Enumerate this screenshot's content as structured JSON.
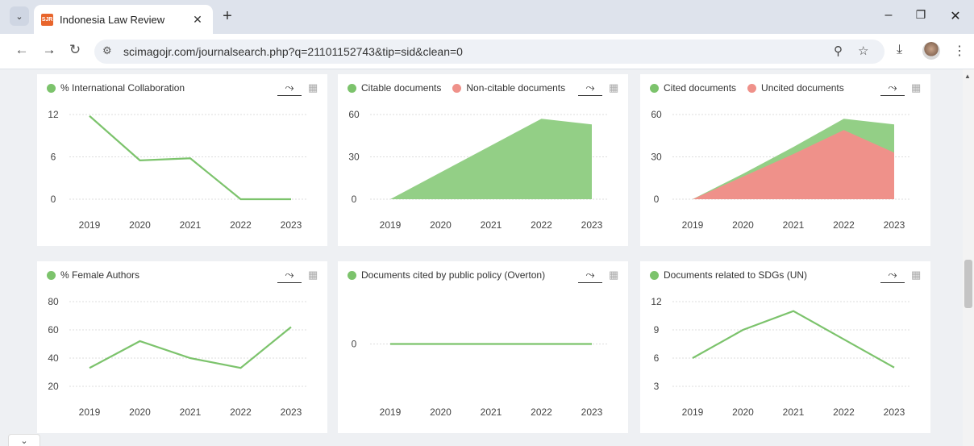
{
  "browser": {
    "tab_title": "Indonesia Law Review",
    "favicon_text": "SJR",
    "url": "scimagojr.com/journalsearch.php?q=21101152743&tip=sid&clean=0"
  },
  "colors": {
    "green": "#93cf86",
    "green_line": "#7cc36c",
    "red": "#ef918a"
  },
  "cards": [
    {
      "legend": [
        {
          "label": "% International Collaboration",
          "color": "#7cc36c"
        }
      ],
      "chart_data": {
        "type": "line",
        "x": [
          "2019",
          "2020",
          "2021",
          "2022",
          "2023"
        ],
        "series": [
          {
            "name": "% International Collaboration",
            "values": [
              11.8,
              5.5,
              5.8,
              0,
              0
            ]
          }
        ],
        "yticks": [
          "12",
          "6",
          "0"
        ],
        "ylim": [
          0,
          12
        ]
      }
    },
    {
      "legend": [
        {
          "label": "Citable documents",
          "color": "#7cc36c"
        },
        {
          "label": "Non-citable documents",
          "color": "#ef918a"
        }
      ],
      "chart_data": {
        "type": "area",
        "x": [
          "2019",
          "2020",
          "2021",
          "2022",
          "2023"
        ],
        "series": [
          {
            "name": "Citable documents",
            "values": [
              0,
              19,
              38,
              57,
              53
            ]
          },
          {
            "name": "Non-citable documents",
            "values": [
              0,
              0,
              0,
              0,
              0
            ]
          }
        ],
        "yticks": [
          "60",
          "30",
          "0"
        ],
        "ylim": [
          0,
          60
        ]
      }
    },
    {
      "legend": [
        {
          "label": "Cited documents",
          "color": "#7cc36c"
        },
        {
          "label": "Uncited documents",
          "color": "#ef918a"
        }
      ],
      "chart_data": {
        "type": "area",
        "x": [
          "2019",
          "2020",
          "2021",
          "2022",
          "2023"
        ],
        "series": [
          {
            "name": "Cited documents",
            "values": [
              0,
              18,
              37,
              57,
              53
            ]
          },
          {
            "name": "Uncited documents",
            "values": [
              0,
              16,
              32,
              49,
              33
            ]
          }
        ],
        "yticks": [
          "60",
          "30",
          "0"
        ],
        "ylim": [
          0,
          60
        ]
      }
    },
    {
      "legend": [
        {
          "label": "% Female Authors",
          "color": "#7cc36c"
        }
      ],
      "chart_data": {
        "type": "line",
        "x": [
          "2019",
          "2020",
          "2021",
          "2022",
          "2023"
        ],
        "series": [
          {
            "name": "% Female Authors",
            "values": [
              33,
              52,
              40,
              33,
              62
            ]
          }
        ],
        "yticks": [
          "80",
          "60",
          "40",
          "20"
        ],
        "ylim": [
          20,
          80
        ]
      }
    },
    {
      "legend": [
        {
          "label": "Documents cited by public policy (Overton)",
          "color": "#7cc36c"
        }
      ],
      "chart_data": {
        "type": "line",
        "x": [
          "2019",
          "2020",
          "2021",
          "2022",
          "2023"
        ],
        "series": [
          {
            "name": "Documents cited by public policy (Overton)",
            "values": [
              0,
              0,
              0,
              0,
              0
            ]
          }
        ],
        "yticks": [
          "0"
        ],
        "ylim": [
          -1,
          1
        ]
      }
    },
    {
      "legend": [
        {
          "label": "Documents related to SDGs (UN)",
          "color": "#7cc36c"
        }
      ],
      "chart_data": {
        "type": "line",
        "x": [
          "2019",
          "2020",
          "2021",
          "2022",
          "2023"
        ],
        "series": [
          {
            "name": "Documents related to SDGs (UN)",
            "values": [
              6,
              9,
              11,
              8,
              5
            ]
          }
        ],
        "yticks": [
          "12",
          "9",
          "6",
          "3"
        ],
        "ylim": [
          3,
          12
        ]
      }
    }
  ]
}
